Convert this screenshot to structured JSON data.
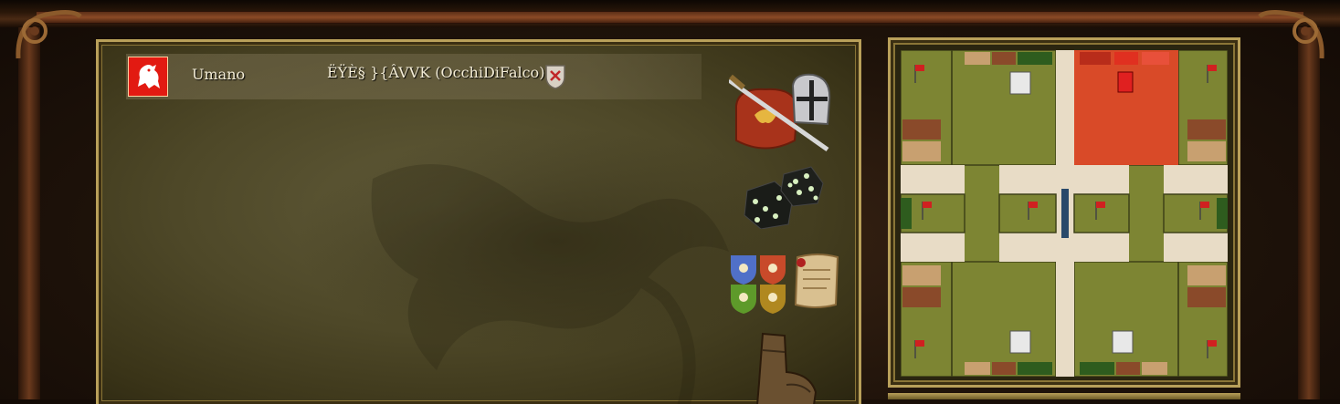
{
  "lobby": {
    "player": {
      "type": "Umano",
      "name": "ËŸÈ§ }{ÂVVK (OcchiDiFalco)",
      "flag_color": "#e21a12"
    },
    "buttons": [
      {
        "name": "start-battle-button",
        "icon": "sword-helmet-shield-icon"
      },
      {
        "name": "random-button",
        "icon": "dice-icon"
      },
      {
        "name": "factions-button",
        "icon": "heraldic-shields-icon"
      },
      {
        "name": "scroll-button",
        "icon": "scroll-icon"
      },
      {
        "name": "leave-button",
        "icon": "boot-icon"
      }
    ]
  },
  "map": {
    "colors": {
      "grass": "#7d8533",
      "road": "#e8dcc6",
      "player_zone": "#d94a28",
      "border": "#1a1a1a"
    }
  }
}
